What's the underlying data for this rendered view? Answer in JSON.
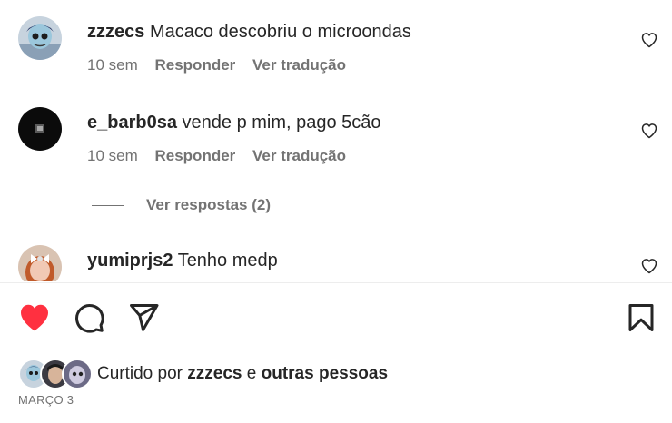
{
  "comments": [
    {
      "username": "zzzecs",
      "text": "Macaco descobriu o microondas",
      "time": "10 sem",
      "reply": "Responder",
      "translate": "Ver tradução"
    },
    {
      "username": "e_barb0sa",
      "text": "vende p mim, pago 5cão",
      "time": "10 sem",
      "reply": "Responder",
      "translate": "Ver tradução",
      "view_replies": "Ver respostas (2)"
    },
    {
      "username": "yumiprjs2",
      "text": "Tenho medp"
    }
  ],
  "likes": {
    "prefix": "Curtido por",
    "user": "zzzecs",
    "conj": "e",
    "others": "outras pessoas"
  },
  "date": "MARÇO 3",
  "icons": {
    "like": "heart-filled-icon",
    "comment": "comment-icon",
    "share": "send-icon",
    "save": "bookmark-icon"
  },
  "colors": {
    "like": "#ff3040",
    "muted": "#737373",
    "text": "#262626"
  }
}
